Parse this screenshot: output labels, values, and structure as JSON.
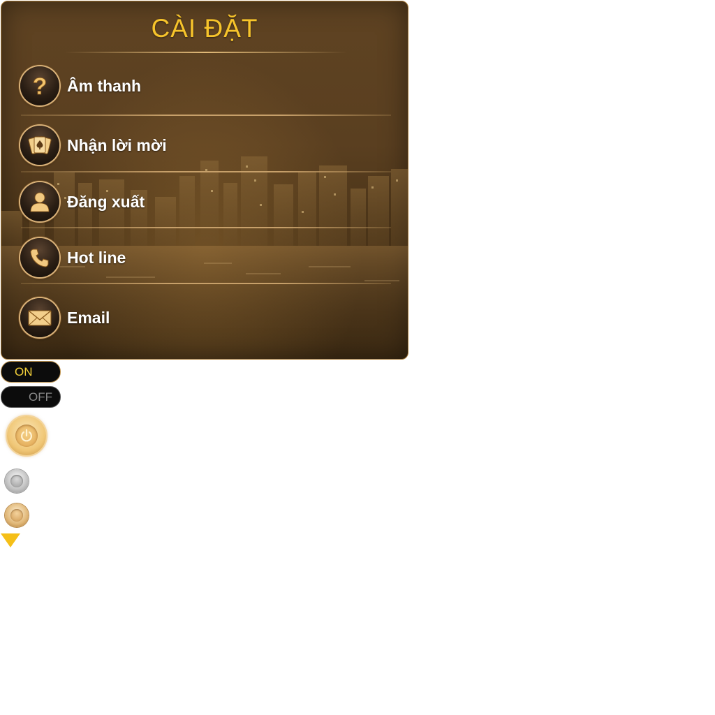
{
  "dialog": {
    "title": "CÀI ĐẶT",
    "items": [
      {
        "label": "Âm thanh",
        "icon": "question-icon"
      },
      {
        "label": "Nhận lời mời",
        "icon": "cards-icon"
      },
      {
        "label": "Đăng xuất",
        "icon": "user-icon"
      },
      {
        "label": "Hot line",
        "icon": "phone-icon"
      },
      {
        "label": "Email",
        "icon": "envelope-icon"
      }
    ]
  },
  "toggles": {
    "on_label": "ON",
    "off_label": "OFF"
  },
  "colors": {
    "title": "#f7c42b",
    "accent_gold": "#d9b27a",
    "toggle_on_text": "#f5d23a",
    "arrow": "#f5bf18"
  }
}
